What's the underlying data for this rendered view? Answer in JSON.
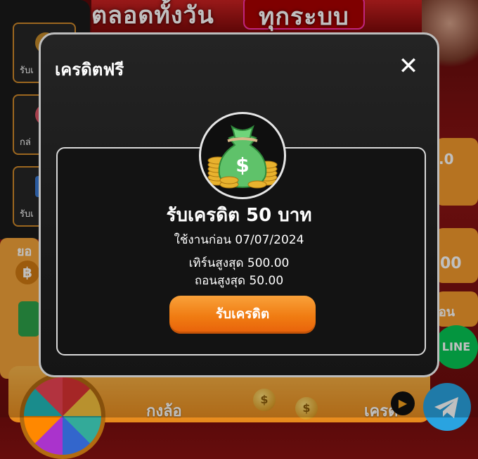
{
  "background": {
    "banner_left": "ตลอดทั้งวัน",
    "banner_right": "ทุกระบบ",
    "side_menu": [
      "รับเ",
      "กล่",
      "รับเ"
    ],
    "left_card_label": "ยอ",
    "left_card_currency": "฿",
    "right_cards": [
      ".0",
      "00",
      "อน"
    ],
    "line_button": "LINE",
    "bottom_labels": [
      "กงล้อ",
      "เครด"
    ],
    "coin_symbol": "$"
  },
  "modal": {
    "title": "เครดิตฟรี",
    "close_icon": "close-icon",
    "credit_title": "รับเครดิต 50 บาท",
    "expiry": "ใช้งานก่อน 07/07/2024",
    "turnover_limit": "เทิร์นสูงสุด 500.00",
    "withdraw_limit": "ถอนสูงสุด 50.00",
    "claim_button": "รับเครดิต",
    "icon": "money-bag-icon"
  },
  "colors": {
    "accent_orange": "#f07c12",
    "modal_bg": "#1a1a1a",
    "modal_border": "#bdbdbd"
  }
}
